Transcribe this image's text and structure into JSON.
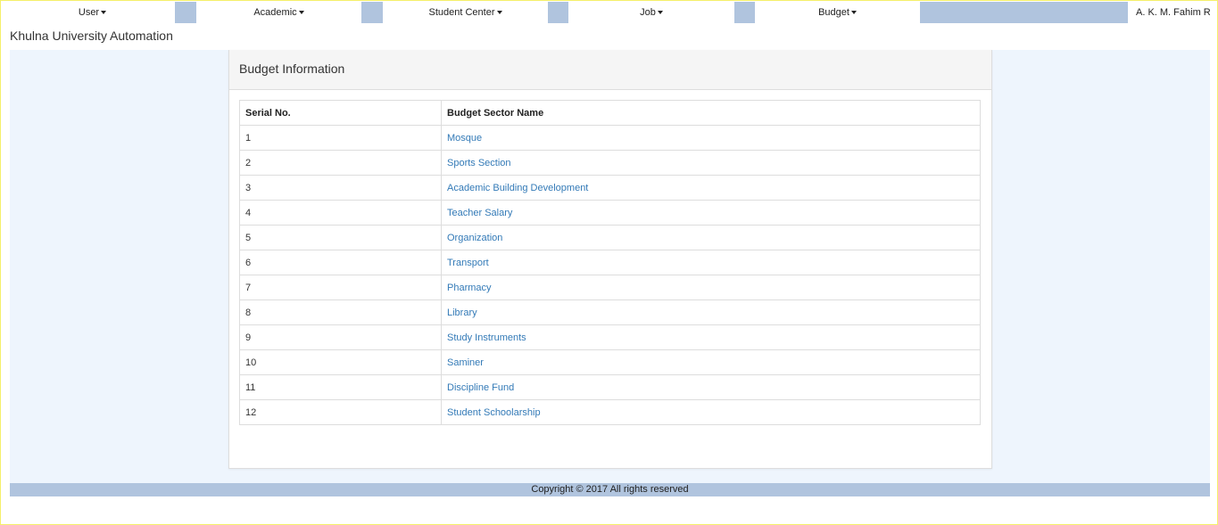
{
  "nav": {
    "items": [
      {
        "label": "User"
      },
      {
        "label": "Academic"
      },
      {
        "label": "Student Center"
      },
      {
        "label": "Job"
      },
      {
        "label": "Budget"
      }
    ],
    "user_name": "A. K. M. Fahim Rahman"
  },
  "brand": "Khulna University Automation",
  "panel": {
    "title": "Budget Information"
  },
  "table": {
    "headers": [
      "Serial No.",
      "Budget Sector Name"
    ],
    "rows": [
      {
        "serial": "1",
        "name": "Mosque"
      },
      {
        "serial": "2",
        "name": "Sports Section"
      },
      {
        "serial": "3",
        "name": "Academic Building Development"
      },
      {
        "serial": "4",
        "name": "Teacher Salary"
      },
      {
        "serial": "5",
        "name": "Organization"
      },
      {
        "serial": "6",
        "name": "Transport"
      },
      {
        "serial": "7",
        "name": "Pharmacy"
      },
      {
        "serial": "8",
        "name": "Library"
      },
      {
        "serial": "9",
        "name": "Study Instruments"
      },
      {
        "serial": "10",
        "name": "Saminer"
      },
      {
        "serial": "11",
        "name": "Discipline Fund"
      },
      {
        "serial": "12",
        "name": "Student Schoolarship"
      }
    ]
  },
  "footer": {
    "text": "Copyright © 2017 All rights reserved"
  },
  "colors": {
    "nav_bg": "#b0c4de",
    "content_bg": "#eef5fd",
    "link": "#337ab7"
  }
}
